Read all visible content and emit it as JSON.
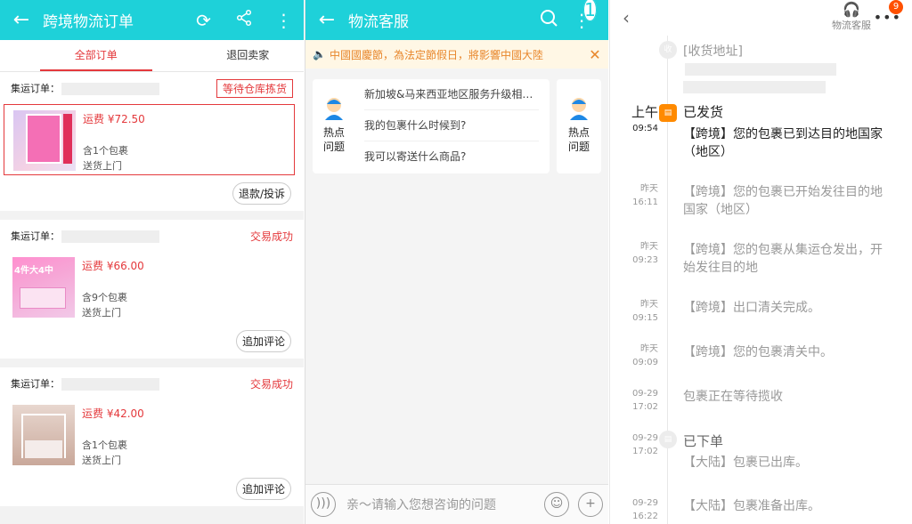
{
  "panel1": {
    "title": "跨境物流订单",
    "tabs": [
      "全部订单",
      "退回卖家"
    ],
    "orders": [
      {
        "label": "集运订单：",
        "status": "等待仓库拣货",
        "price": "运费 ¥72.50",
        "count": "含1个包裹",
        "delivery": "送货上门",
        "action": "退款/投诉"
      },
      {
        "label": "集运订单：",
        "status": "交易成功",
        "price": "运费 ¥66.00",
        "count": "含9个包裹",
        "delivery": "送货上门",
        "action": "追加评论"
      },
      {
        "label": "集运订单：",
        "status": "交易成功",
        "price": "运费 ¥42.00",
        "count": "含1个包裹",
        "delivery": "送货上门",
        "action": "追加评论"
      }
    ],
    "thumb2_text": "4件大4中"
  },
  "panel2": {
    "title": "物流客服",
    "badge": "1",
    "notice": "中國國慶節，為法定節假日，將影響中國大陸",
    "hot_label": "热点问题",
    "questions": [
      "新加坡&马来西亚地区服务升级相…",
      "我的包裹什么时候到?",
      "我可以寄送什么商品?"
    ],
    "input_placeholder": "亲～请输入您想咨询的问题"
  },
  "panel3": {
    "service_label": "物流客服",
    "badge": "9",
    "address_label": "[收货地址]",
    "addr_dot": "收",
    "events": [
      {
        "date": "上午",
        "time": "09:54",
        "title": "已发货",
        "text": "【跨境】您的包裹已到达目的地国家（地区）"
      },
      {
        "date": "昨天",
        "time": "16:11",
        "text": "【跨境】您的包裹已开始发往目的地国家（地区）"
      },
      {
        "date": "昨天",
        "time": "09:23",
        "text": "【跨境】您的包裹从集运仓发出，开始发往目的地"
      },
      {
        "date": "昨天",
        "time": "09:15",
        "text": "【跨境】出口清关完成。"
      },
      {
        "date": "昨天",
        "time": "09:09",
        "text": "【跨境】您的包裹清关中。"
      },
      {
        "date": "09-29",
        "time": "17:02",
        "text": "包裹正在等待揽收"
      },
      {
        "date": "09-29",
        "time": "17:02",
        "title": "已下单",
        "text": "【大陆】包裹已出库。"
      },
      {
        "date": "09-29",
        "time": "16:22",
        "text": "【大陆】包裹准备出库。"
      }
    ]
  }
}
